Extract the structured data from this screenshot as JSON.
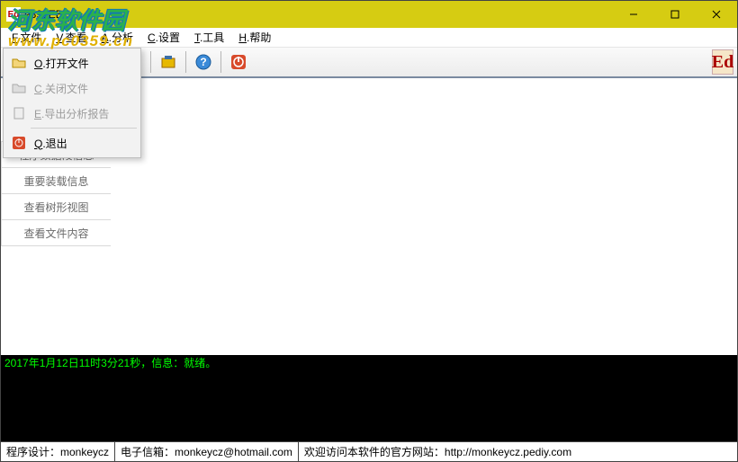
{
  "title": "9896EB",
  "watermark": {
    "text": "河东软件园",
    "url": "www.pc0359.cn"
  },
  "menu": {
    "file": {
      "letter": "F",
      "label": ".文件"
    },
    "view": {
      "letter": "V",
      "label": ".查看"
    },
    "analyze": {
      "letter": "A",
      "label": ".分析"
    },
    "config": {
      "letter": "C",
      "label": ".设置"
    },
    "tools": {
      "letter": "T",
      "label": ".工具"
    },
    "help": {
      "letter": "H",
      "label": ".帮助"
    }
  },
  "dropdown": {
    "open": {
      "letter": "O",
      "label": ".打开文件"
    },
    "close": {
      "letter": "C",
      "label": ".关闭文件"
    },
    "export": {
      "letter": "E",
      "label": ".导出分析报告"
    },
    "quit": {
      "letter": "Q",
      "label": ".退出"
    }
  },
  "sidebar": {
    "items": [
      {
        "label": "程序数据段信息"
      },
      {
        "label": "重要装载信息"
      },
      {
        "label": "查看树形视图"
      },
      {
        "label": "查看文件内容"
      }
    ]
  },
  "console": {
    "line": "2017年1月12日11时3分21秒，信息：就绪。"
  },
  "status": {
    "design": "程序设计：monkeycz",
    "email": "电子信箱：monkeycz@hotmail.com",
    "site": "欢迎访问本软件的官方网站：http://monkeycz.pediy.com"
  }
}
